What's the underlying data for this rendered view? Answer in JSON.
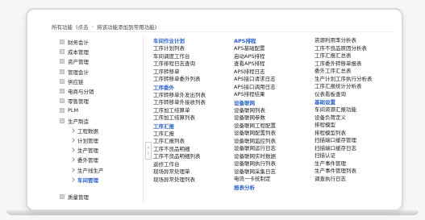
{
  "breadcrumb": [
    "所有功能",
    "(点击",
    "将该功能添加到常用功能)"
  ],
  "sidebar": {
    "items": [
      {
        "label": "财务会计"
      },
      {
        "label": "成本管理"
      },
      {
        "label": "资产管理"
      },
      {
        "label": "管理会计"
      },
      {
        "label": "供应链"
      },
      {
        "label": "电商与分销"
      },
      {
        "label": "零售管理"
      },
      {
        "label": "PLM"
      },
      {
        "label": "生产制造"
      }
    ],
    "sub_items": [
      {
        "label": "工程数据"
      },
      {
        "label": "计划管理"
      },
      {
        "label": "生产管理"
      },
      {
        "label": "委外管理"
      },
      {
        "label": "生产线生产"
      },
      {
        "label": "车间管理"
      }
    ],
    "bottom_item": "质量管理"
  },
  "columns": [
    {
      "title": "车间作业计划",
      "items": [
        "工序计划列表",
        "车间调度工作台",
        "工序排程日志查询",
        "工序转移单",
        "工序转移单委外列表"
      ]
    },
    {
      "title": "工序委外",
      "items": [
        "工序转移单外发出列表",
        "工序转移单外接收列表",
        "工序加工结算单",
        "工序加工结算列表"
      ]
    },
    {
      "title": "工序汇报",
      "items": [
        "工序汇报",
        "工序汇报列表",
        "工序不良品明细",
        "工序不良品明细列表",
        "返修工作台",
        "现场异常处理单",
        "现场异常处理列表"
      ]
    },
    {
      "title": "APS排程",
      "items": [
        "APS基础配置",
        "启动APS排程",
        "查看APS排程",
        "APS排程日志",
        "APS接口请求日志",
        "APS接口调用日志",
        "APS排程结果"
      ]
    },
    {
      "title": "设备联网",
      "items": [
        "设备联网列表",
        "设备联网参数",
        "设备联网工程配置",
        "设备联网配置列表",
        "设备联网监控列表",
        "设备联网运行日志",
        "设备联网实时数据",
        "设备联网执行列表",
        "设备联网采集日志",
        "电讯一卡统制定"
      ]
    },
    {
      "title": "报表分析",
      "items": []
    },
    {
      "title": "",
      "items": [
        "资源利用率分析表",
        "工序不良品原因分析表",
        "工序汇报汇总表",
        "工序委外转移单报表",
        "委外工序汇总表",
        "生产计划工序执行分析表",
        "工序汇报统计分析表",
        "仪表看板查询"
      ]
    },
    {
      "title": "基础设置",
      "items": [
        "车间资源汇报功能",
        "设备负荷定义",
        "排程模型",
        "排程模型列表",
        "扫描端口缓存管理",
        "扫描端口缓存日志",
        "扫描认证",
        "生产事件管理",
        "生产事件管理列表",
        "调查执行日志"
      ]
    }
  ]
}
